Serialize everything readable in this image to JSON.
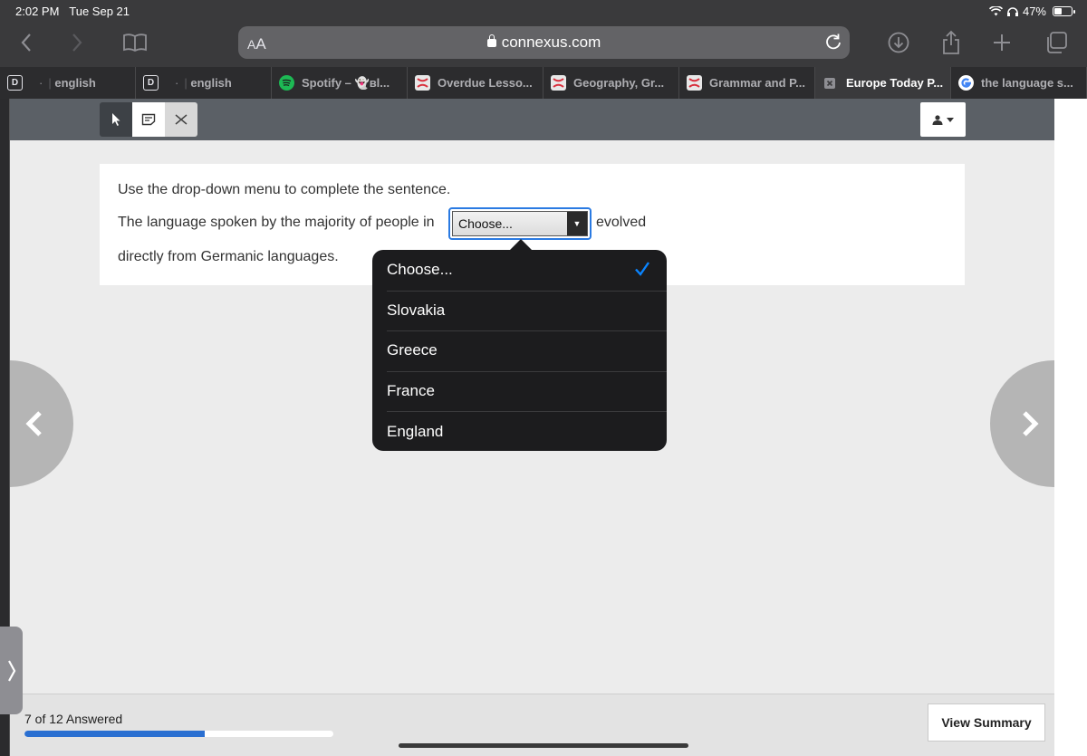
{
  "status": {
    "time": "2:02 PM",
    "date": "Tue Sep 21",
    "battery": "47%"
  },
  "browser": {
    "aa_small": "A",
    "aa_big": "A",
    "domain": "connexus.com",
    "tabs": [
      {
        "favicon": "D",
        "title": "english",
        "prefix": "·"
      },
      {
        "favicon": "D",
        "title": "english",
        "prefix": "·"
      },
      {
        "favicon": "spotify",
        "title": "Spotify – 👻ʙl..."
      },
      {
        "favicon": "connexus",
        "title": "Overdue Lesso..."
      },
      {
        "favicon": "connexus",
        "title": "Geography, Gr..."
      },
      {
        "favicon": "connexus",
        "title": "Grammar and P..."
      },
      {
        "favicon": "close",
        "title": "Europe Today P..."
      },
      {
        "favicon": "google",
        "title": "the language s..."
      }
    ]
  },
  "question": {
    "instruction": "Use the drop-down menu to complete the sentence.",
    "sentence_before": "The language spoken by the majority of people in",
    "sentence_after": "evolved",
    "sentence_line3": "directly from Germanic languages.",
    "select_value": "Choose..."
  },
  "dropdown": {
    "options": [
      "Choose...",
      "Slovakia",
      "Greece",
      "France",
      "England"
    ],
    "selected": "Choose..."
  },
  "footer": {
    "answered_text": "7 of 12 Answered",
    "progress_fraction": 0.583,
    "summary_button": "View Summary"
  },
  "colors": {
    "accent": "#2a7ae2",
    "progress": "#2a6fd1",
    "checkmark": "#0a84ff"
  }
}
